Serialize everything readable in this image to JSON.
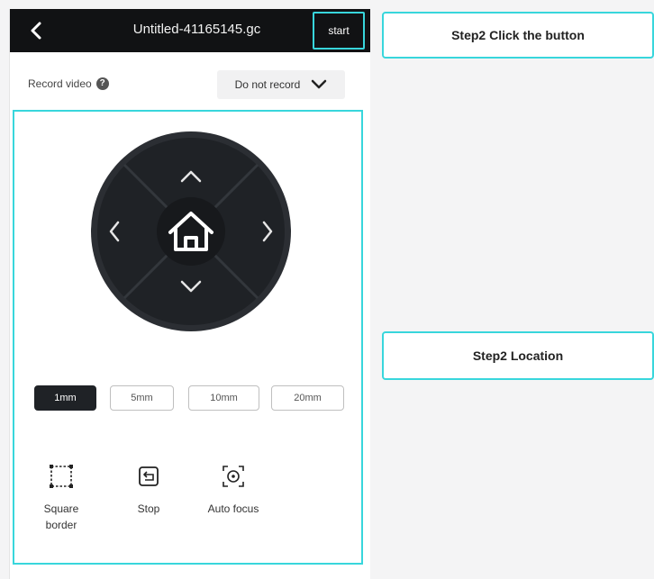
{
  "header": {
    "title": "Untitled-41165145.gc",
    "start_label": "start"
  },
  "record": {
    "label": "Record video",
    "help_icon": "question-icon",
    "selected": "Do not record"
  },
  "steps": [
    {
      "label": "1mm",
      "active": true
    },
    {
      "label": "5mm",
      "active": false
    },
    {
      "label": "10mm",
      "active": false
    },
    {
      "label": "20mm",
      "active": false
    }
  ],
  "tools": [
    {
      "label": "Square border",
      "icon": "square-border-icon"
    },
    {
      "label": "Stop",
      "icon": "stop-icon"
    },
    {
      "label": "Auto focus",
      "icon": "auto-focus-icon"
    }
  ],
  "callouts": {
    "step_click": "Step2 Click the button",
    "step_location": "Step2 Location"
  },
  "colors": {
    "accent": "#38d6dc",
    "topbar": "#111214",
    "dpad": "#1f2226"
  }
}
